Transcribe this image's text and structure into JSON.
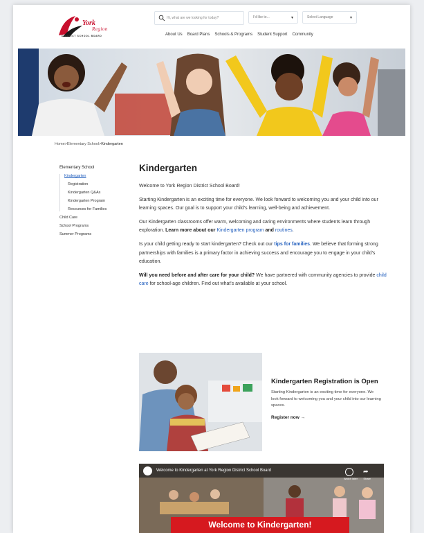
{
  "header": {
    "logo": {
      "primary": "York",
      "secondary": "Region",
      "subtitle": "DISTRICT SCHOOL BOARD"
    },
    "search": {
      "placeholder": "Hi, what are we looking for today?"
    },
    "like_to": {
      "value": "I'd like to..."
    },
    "language": {
      "value": "Select Language"
    },
    "nav": [
      "About Us",
      "Board Plans",
      "Schools & Programs",
      "Student Support",
      "Community"
    ]
  },
  "breadcrumb": {
    "items": [
      "Home",
      "Elementary School",
      "Kindergarten"
    ],
    "separator": ">"
  },
  "sidebar": {
    "section": "Elementary School",
    "items": [
      {
        "label": "Kindergarten",
        "active": true
      },
      {
        "label": "Registration"
      },
      {
        "label": "Kindergarten Q&As"
      },
      {
        "label": "Kindergarten Program"
      },
      {
        "label": "Resources for Families"
      }
    ],
    "other": [
      "Child Care",
      "School Programs",
      "Summer Programs"
    ]
  },
  "main": {
    "title": "Kindergarten",
    "p1": "Welcome to York Region District School Board!",
    "p2": "Starting Kindergarten is an exciting time for everyone. We look forward to welcoming you and your child into our learning spaces. Our goal is to support your child's learning, well-being and achievement.",
    "p3_text": "Our Kindergarten classrooms offer warm, welcoming and caring environments where students learn through exploration. ",
    "p3_bold": "Learn more about our ",
    "p3_link1": "Kindergarten program",
    "p3_and": " and ",
    "p3_link2": "routines",
    "p3_end": ".",
    "p4_text": "Is your child getting ready to start kindergarten? Check out our ",
    "p4_link": "tips for families",
    "p4_rest": ". We believe that forming strong partnerships with families is a primary factor in achieving success and encourage you to engage in your child's education.",
    "p5_bold": "Will you need before and after care for your child?",
    "p5_text": " We have partnered with community agencies to provide ",
    "p5_link": "child care",
    "p5_rest": " for school-age children. Find out what's available at your school."
  },
  "card": {
    "title": "Kindergarten Registration is Open",
    "text": "Starting Kindergarten is an exciting time for everyone. We look forward to welcoming you and your child into our learning spaces.",
    "link": "Register now",
    "arrow": "→"
  },
  "video": {
    "title": "Welcome to Kindergarten at York Region District School Board",
    "banner": "Welcome to Kindergarten!",
    "controls": [
      "Watch later",
      "Share"
    ]
  },
  "colors": {
    "brand_red": "#c8102e",
    "link_blue": "#1f5dbd",
    "banner_red": "#d6191f"
  }
}
